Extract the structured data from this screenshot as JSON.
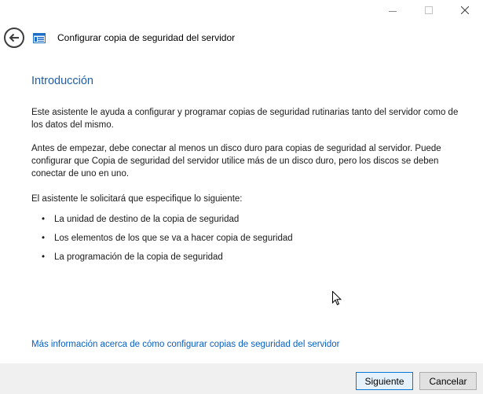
{
  "window": {
    "controls": [
      "minimize",
      "maximize",
      "close"
    ]
  },
  "header": {
    "title": "Configurar copia de seguridad del servidor",
    "back_icon": "back-arrow-icon",
    "app_icon": "backup-icon"
  },
  "content": {
    "heading": "Introducción",
    "paragraph1": "Este asistente le ayuda a configurar y programar copias de seguridad rutinarias tanto del servidor como de los datos del mismo.",
    "paragraph2": "Antes de empezar, debe conectar al menos un disco duro para copias de seguridad al servidor. Puede configurar que Copia de seguridad del servidor utilice más de un disco duro, pero los discos se deben conectar de uno en uno.",
    "paragraph3": "El asistente le solicitará que especifique lo siguiente:",
    "items": [
      "La unidad de destino de la copia de seguridad",
      "Los elementos de los que se va a hacer copia de seguridad",
      "La programación de la copia de seguridad"
    ],
    "link": "Más información acerca de cómo configurar copias de seguridad del servidor"
  },
  "footer": {
    "next_label": "Siguiente",
    "cancel_label": "Cancelar"
  },
  "colors": {
    "heading": "#1e5eab",
    "link": "#0a5fbd",
    "footer_bg": "#f0f0f0",
    "default_button_border": "#0078d7"
  }
}
